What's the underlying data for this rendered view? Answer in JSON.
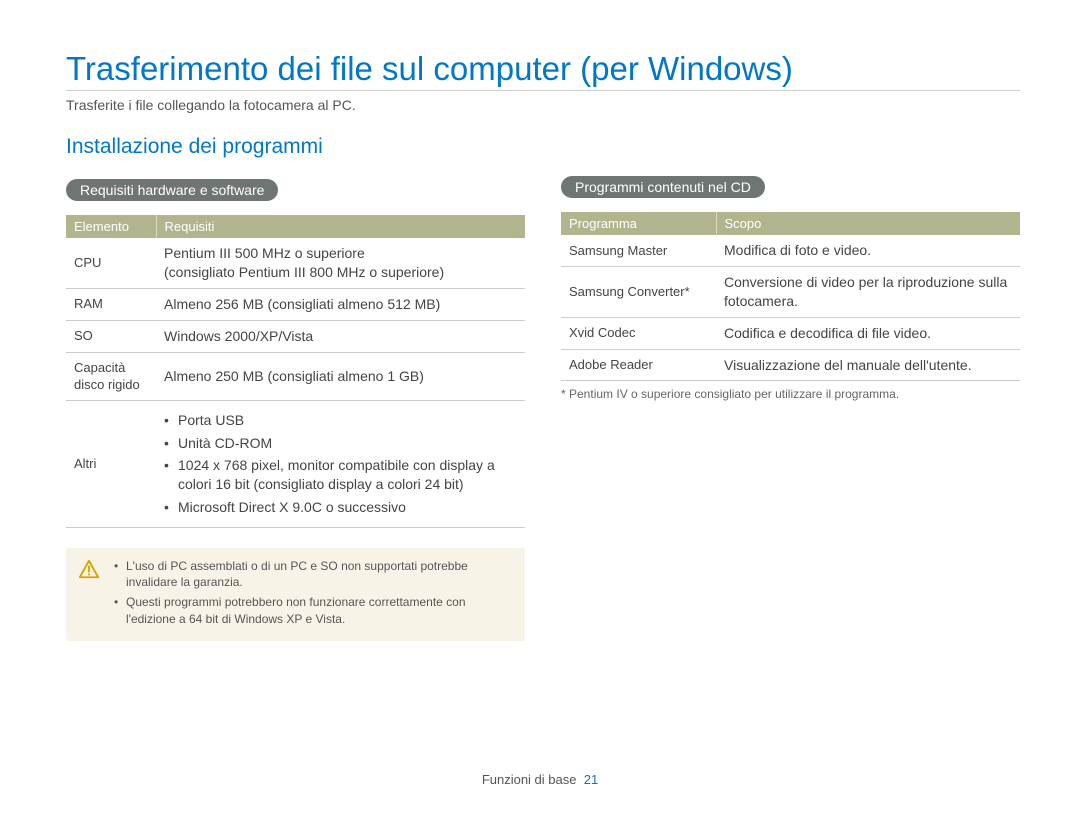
{
  "title": "Trasferimento dei file sul computer (per Windows)",
  "intro": "Trasferite i file collegando la fotocamera al PC.",
  "left": {
    "section_title": "Installazione dei programmi",
    "pill": "Requisiti hardware e software",
    "headers": {
      "col1": "Elemento",
      "col2": "Requisiti"
    },
    "rows": {
      "cpu": {
        "label": "CPU",
        "value": "Pentium III 500 MHz o superiore\n(consigliato Pentium III 800 MHz o superiore)"
      },
      "ram": {
        "label": "RAM",
        "value": "Almeno 256 MB (consigliati almeno 512 MB)"
      },
      "os": {
        "label": "SO",
        "value": "Windows 2000/XP/Vista"
      },
      "disk": {
        "label": "Capacità disco rigido",
        "value": "Almeno 250 MB (consigliati almeno 1 GB)"
      },
      "other_label": "Altri",
      "other_items": {
        "a": "Porta USB",
        "b": "Unità CD-ROM",
        "c": "1024 x 768 pixel, monitor compatibile con display a colori 16 bit (consigliato display a colori 24 bit)",
        "d": "Microsoft Direct X 9.0C o successivo"
      }
    },
    "warn": {
      "a": "L'uso di PC assemblati o di un PC e SO non supportati potrebbe invalidare la garanzia.",
      "b": "Questi programmi potrebbero non funzionare correttamente con l'edizione a 64 bit di Windows XP e Vista."
    }
  },
  "right": {
    "pill": "Programmi contenuti nel CD",
    "headers": {
      "col1": "Programma",
      "col2": "Scopo"
    },
    "rows": {
      "r1": {
        "label": "Samsung Master",
        "value": "Modifica di foto e video."
      },
      "r2": {
        "label": "Samsung Converter*",
        "value": "Conversione di video per la riproduzione sulla fotocamera."
      },
      "r3": {
        "label": "Xvid Codec",
        "value": "Codifica e decodifica di file video."
      },
      "r4": {
        "label": "Adobe Reader",
        "value": "Visualizzazione del manuale dell'utente."
      }
    },
    "footnote": "* Pentium IV o superiore consigliato per utilizzare il programma."
  },
  "footer": {
    "section": "Funzioni di base",
    "page": "21"
  }
}
